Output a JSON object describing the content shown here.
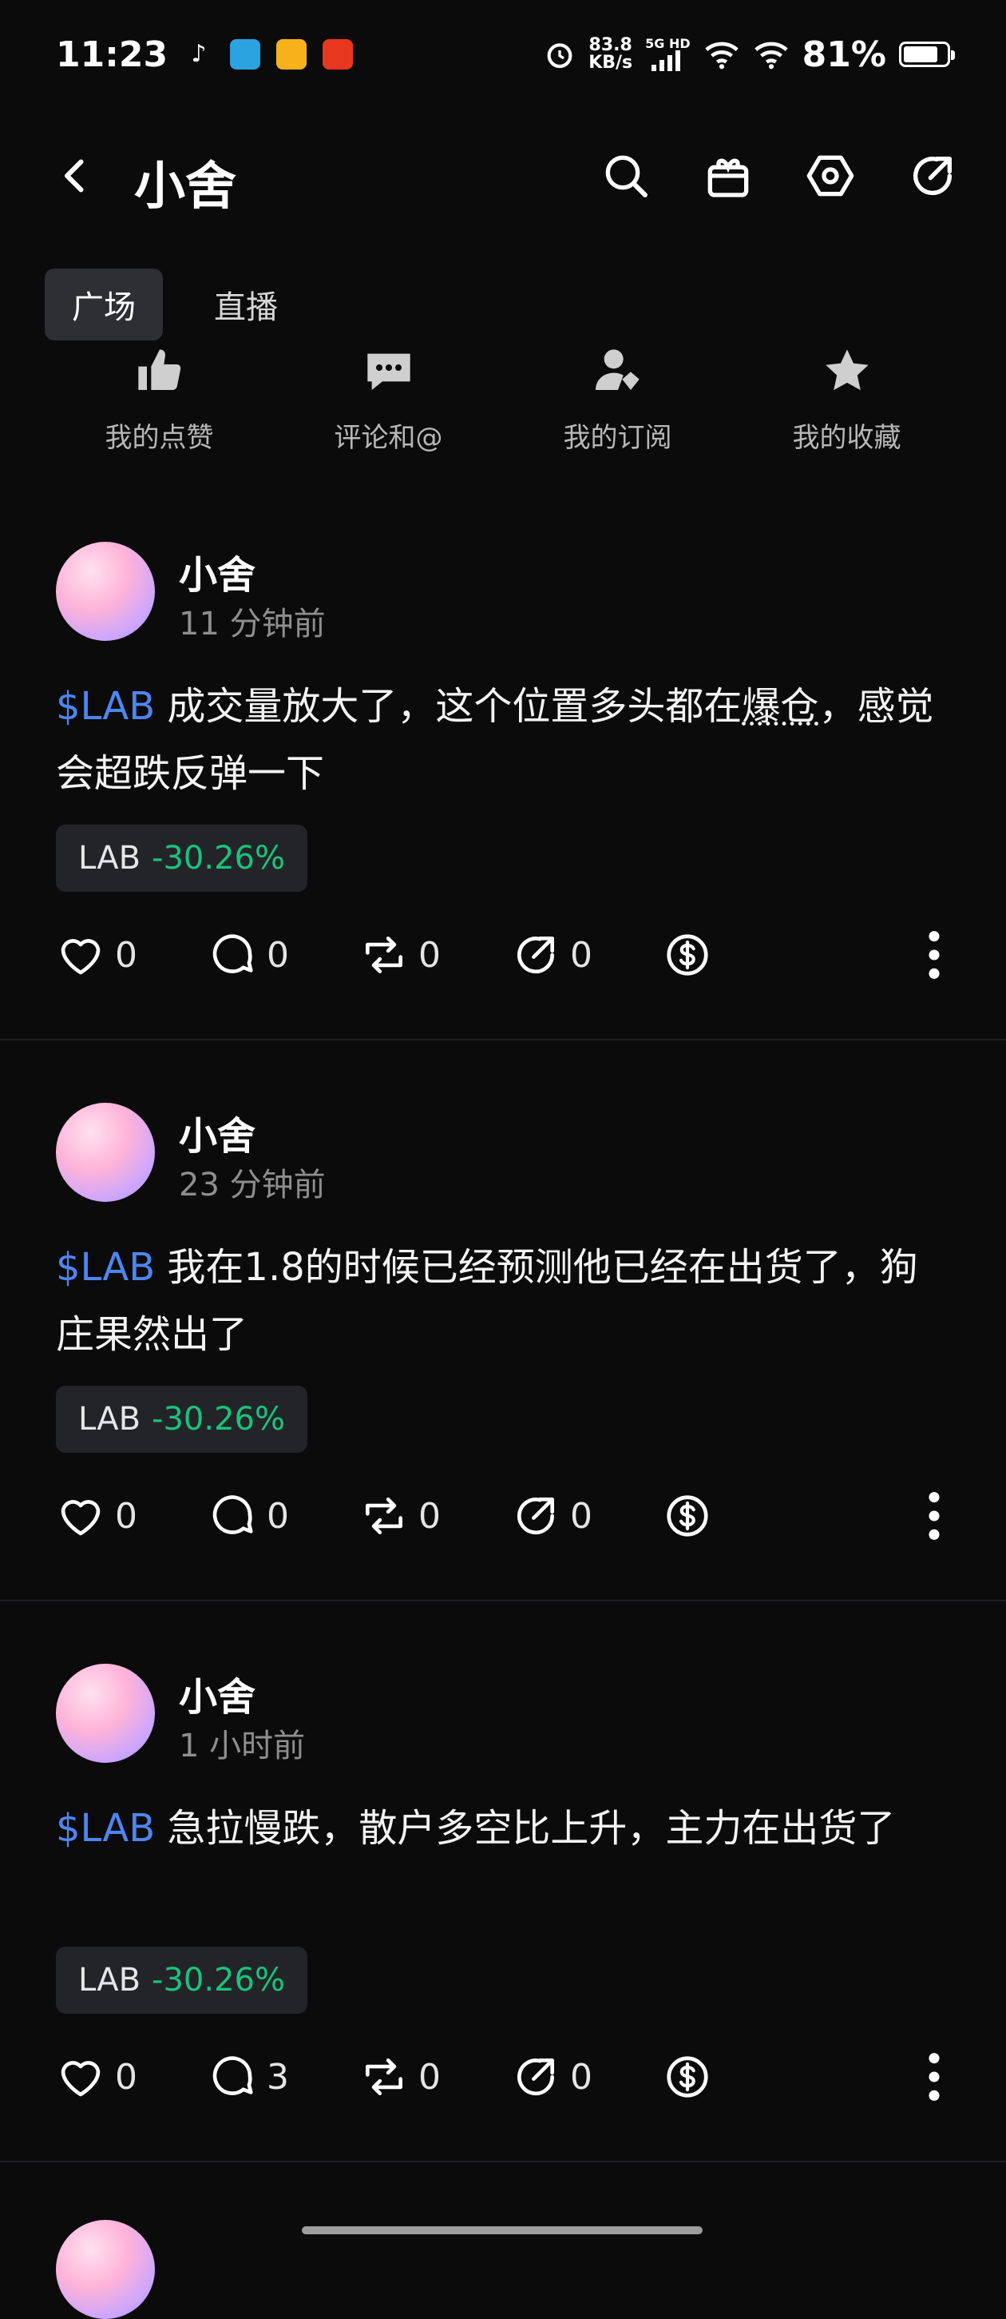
{
  "status": {
    "time": "11:23",
    "net_speed_value": "83.8",
    "net_speed_unit": "KB/s",
    "network": "5G HD",
    "battery": "81%",
    "battery_level": 0.81
  },
  "header": {
    "title": "小舍",
    "icons": [
      "back-icon",
      "search-icon",
      "gift-icon",
      "settings-icon",
      "share-icon"
    ]
  },
  "tabs": [
    {
      "label": "广场"
    },
    {
      "label": "直播"
    }
  ],
  "shortcuts": [
    {
      "label": "我的点赞",
      "icon": "thumbs-up-icon"
    },
    {
      "label": "评论和@",
      "icon": "comment-icon"
    },
    {
      "label": "我的订阅",
      "icon": "subscribe-user-icon"
    },
    {
      "label": "我的收藏",
      "icon": "star-icon"
    }
  ],
  "posts": [
    {
      "author": "小舍",
      "time": "11 分钟前",
      "ticker": "$LAB",
      "text_before": " 成交量放大了，这个位置多头都在",
      "text_link": "爆仓",
      "text_after": "，感觉会超跌反弹一下",
      "chip_symbol": "LAB",
      "chip_change": "-30.26%",
      "likes": "0",
      "comments": "0",
      "reposts": "0",
      "shares": "0"
    },
    {
      "author": "小舍",
      "time": "23 分钟前",
      "ticker": "$LAB",
      "text_before": " 我在1.8的时候已经预测他已经在出货了，狗庄果然出了",
      "text_link": "",
      "text_after": "",
      "chip_symbol": "LAB",
      "chip_change": "-30.26%",
      "likes": "0",
      "comments": "0",
      "reposts": "0",
      "shares": "0"
    },
    {
      "author": "小舍",
      "time": "1 小时前",
      "ticker": "$LAB",
      "text_before": " 急拉慢跌，散户多空比上升，主力在出货了",
      "text_link": "",
      "text_after": "",
      "chip_symbol": "LAB",
      "chip_change": "-30.26%",
      "likes": "0",
      "comments": "3",
      "reposts": "0",
      "shares": "0"
    }
  ],
  "colors": {
    "background": "#0b0b0c",
    "ticker": "#4e86f0",
    "negative_change": "#19c37d",
    "chip_bg": "#232428"
  }
}
